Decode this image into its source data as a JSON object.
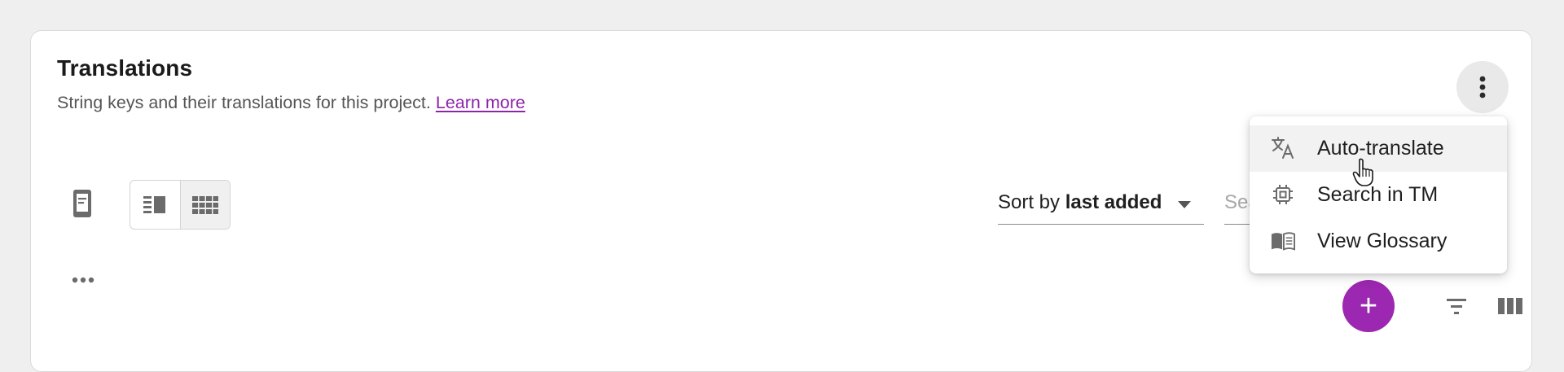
{
  "panel": {
    "title": "Translations",
    "subtitle": "String keys and their translations for this project.",
    "learn_more": "Learn more"
  },
  "toolbar": {
    "sort_prefix": "Sort by ",
    "sort_value": "last added",
    "search_placeholder": "Search",
    "add_label": "+"
  },
  "menu": {
    "items": [
      {
        "label": "Auto-translate",
        "icon": "translate-icon",
        "hovered": true
      },
      {
        "label": "Search in TM",
        "icon": "chip-icon",
        "hovered": false
      },
      {
        "label": "View Glossary",
        "icon": "book-icon",
        "hovered": false
      }
    ]
  },
  "colors": {
    "accent": "#9c27b0",
    "link": "#8e24aa",
    "icon": "#6b6b6b",
    "background": "#efefef"
  }
}
